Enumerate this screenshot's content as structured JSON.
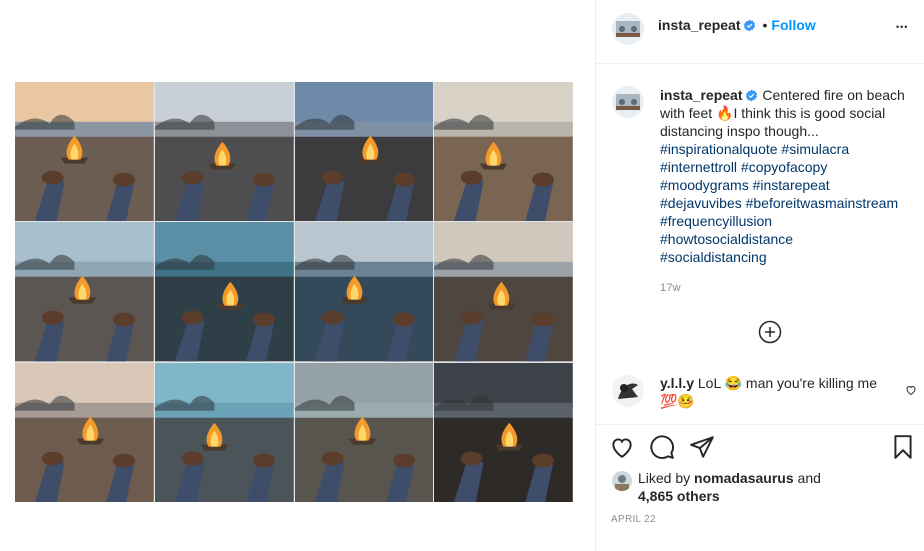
{
  "post": {
    "username": "insta_repeat",
    "follow_label": "Follow",
    "dot": "•",
    "more_label": "•••",
    "caption_text": "Centered fire on beach with feet 🔥I think this is good social distancing inspo though...",
    "hashtags": [
      "#inspirationalquote #simulacra",
      "#internettroll #copyofacopy",
      "#moodygrams #instarepeat",
      "#dejavuvibes #beforeitwasmainstream",
      "#frequencyillusion",
      "#howtosocialdistance",
      "#socialdistancing"
    ],
    "time_ago": "17w",
    "date": "APRIL 22"
  },
  "comment": {
    "username": "y.l.l.y",
    "text": "LoL 😂 man you're killing me 💯🤒"
  },
  "likes": {
    "prefix": "Liked by",
    "user": "nomadasaurus",
    "and": "and",
    "others": "4,865 others"
  },
  "icons": {
    "header_verified": "verified-badge-icon",
    "caption_verified": "verified-badge-icon",
    "load_more": "plus-circle-icon",
    "comment_like": "heart-icon",
    "like": "heart-icon",
    "comment": "comment-bubble-icon",
    "share": "paper-plane-icon",
    "save": "bookmark-icon"
  },
  "colors": {
    "accent": "#0095f6",
    "hashtag": "#00376b",
    "muted": "#8e8e8e"
  },
  "media": {
    "tiles": [
      {
        "sky": "#e8c7a2",
        "ground": "#6b5d52",
        "water": "#8d97a3"
      },
      {
        "sky": "#c9cfd6",
        "ground": "#4e4e50",
        "water": "#8c9298"
      },
      {
        "sky": "#6f8aa8",
        "ground": "#3c3b3d",
        "water": "#7d90a6"
      },
      {
        "sky": "#d8d2c6",
        "ground": "#7a6552",
        "water": "#b8b4ab"
      },
      {
        "sky": "#a8bfcd",
        "ground": "#5c5652",
        "water": "#8fa6b4"
      },
      {
        "sky": "#5a8fa6",
        "ground": "#2e3f48",
        "water": "#3f7287"
      },
      {
        "sky": "#b9c6cf",
        "ground": "#34495a",
        "water": "#6a8293"
      },
      {
        "sky": "#d0c8bc",
        "ground": "#4f4640",
        "water": "#9ca3a8"
      },
      {
        "sky": "#d9c8b8",
        "ground": "#6d5c4e",
        "water": "#a69c95"
      },
      {
        "sky": "#7fb6c8",
        "ground": "#4b5458",
        "water": "#6aa3b8"
      },
      {
        "sky": "#94a2a8",
        "ground": "#58554f",
        "water": "#9cabae"
      },
      {
        "sky": "#3d4248",
        "ground": "#2e2a27",
        "water": "#5b6168"
      }
    ]
  }
}
